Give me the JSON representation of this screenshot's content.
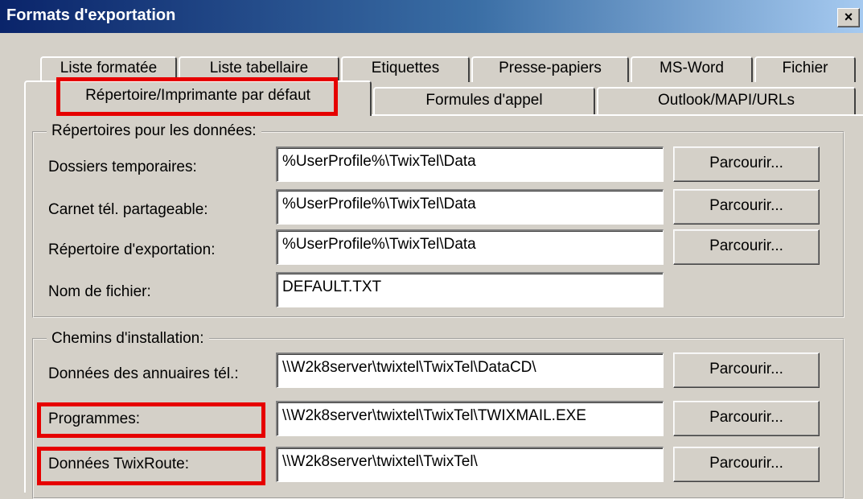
{
  "window": {
    "title": "Formats d'exportation",
    "close_label": "×"
  },
  "tabs": {
    "row1": [
      "Liste formatée",
      "Liste tabellaire",
      "Etiquettes",
      "Presse-papiers",
      "MS-Word",
      "Fichier"
    ],
    "row2": [
      "Répertoire/Imprimante par défaut",
      "Formules d'appel",
      "Outlook/MAPI/URLs"
    ],
    "active": "Répertoire/Imprimante par défaut"
  },
  "data_dirs": {
    "title": "Répertoires pour les données:",
    "rows": [
      {
        "label": "Dossiers temporaires:",
        "value": "%UserProfile%\\TwixTel\\Data",
        "button": "Parcourir..."
      },
      {
        "label": "Carnet tél. partageable:",
        "value": "%UserProfile%\\TwixTel\\Data",
        "button": "Parcourir..."
      },
      {
        "label": "Répertoire d'exportation:",
        "value": "%UserProfile%\\TwixTel\\Data",
        "button": "Parcourir..."
      },
      {
        "label": "Nom de fichier:",
        "value": "DEFAULT.TXT"
      }
    ]
  },
  "install_paths": {
    "title": "Chemins d'installation:",
    "rows": [
      {
        "label": "Données des annuaires tél.:",
        "value": "\\\\W2k8server\\twixtel\\TwixTel\\DataCD\\",
        "button": "Parcourir..."
      },
      {
        "label": "Programmes:",
        "value": "\\\\W2k8server\\twixtel\\TwixTel\\TWIXMAIL.EXE",
        "button": "Parcourir..."
      },
      {
        "label": "Données TwixRoute:",
        "value": "\\\\W2k8server\\twixtel\\TwixTel\\",
        "button": "Parcourir..."
      }
    ]
  },
  "colors": {
    "highlight": "#e60000",
    "title_bar": "#0a246a",
    "dialog_bg": "#d4d0c8"
  }
}
